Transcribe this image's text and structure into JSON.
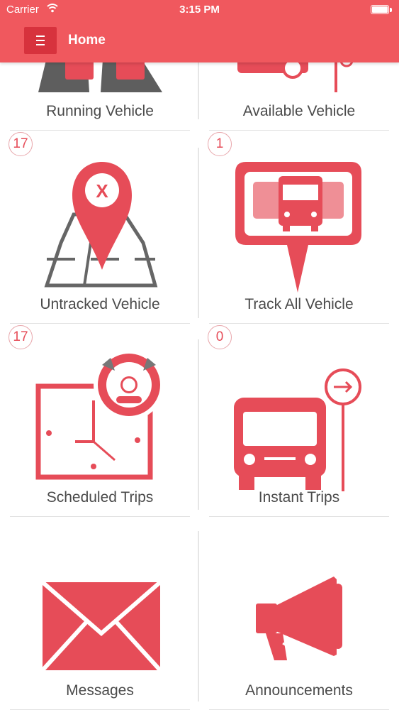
{
  "status_bar": {
    "carrier": "Carrier",
    "time": "3:15 PM"
  },
  "header": {
    "title": "Home"
  },
  "tiles": [
    {
      "label": "Running Vehicle",
      "badge": "",
      "icon": "road-vehicle-icon"
    },
    {
      "label": "Available Vehicle",
      "badge": "",
      "icon": "vehicle-sign-icon"
    },
    {
      "label": "Untracked Vehicle",
      "badge": "17",
      "icon": "map-pin-x-icon"
    },
    {
      "label": "Track All Vehicle",
      "badge": "1",
      "icon": "bus-fleet-icon"
    },
    {
      "label": "Scheduled Trips",
      "badge": "17",
      "icon": "clock-steering-icon"
    },
    {
      "label": "Instant Trips",
      "badge": "0",
      "icon": "bus-stop-icon"
    },
    {
      "label": "Messages",
      "badge": "",
      "icon": "envelope-icon"
    },
    {
      "label": "Announcements",
      "badge": "",
      "icon": "megaphone-icon"
    }
  ],
  "colors": {
    "accent": "#f0585e",
    "icon_red": "#e64c58",
    "icon_gray": "#666666"
  }
}
